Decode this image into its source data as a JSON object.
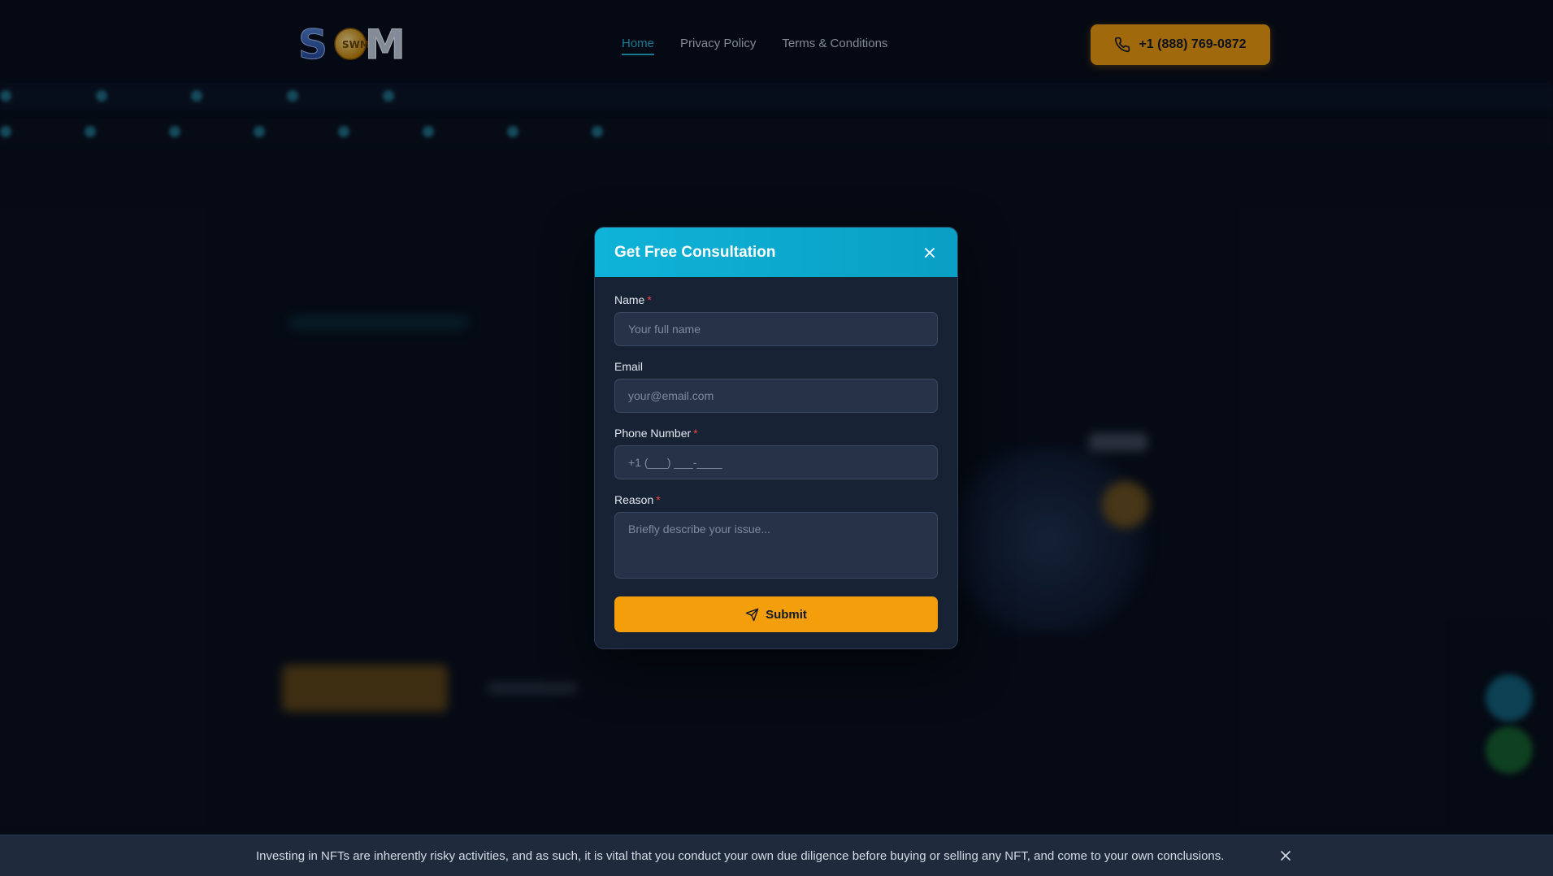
{
  "header": {
    "logo_text": "SWM",
    "nav": [
      {
        "label": "Home",
        "active": true
      },
      {
        "label": "Privacy Policy",
        "active": false
      },
      {
        "label": "Terms & Conditions",
        "active": false
      }
    ],
    "phone_label": "+1 (888) 769-0872"
  },
  "modal": {
    "title": "Get Free Consultation",
    "fields": {
      "name": {
        "label": "Name",
        "required_mark": "*",
        "placeholder": "Your full name"
      },
      "email": {
        "label": "Email",
        "placeholder": "your@email.com"
      },
      "phone": {
        "label": "Phone Number",
        "required_mark": "*",
        "placeholder": "+1 (___) ___-____"
      },
      "reason": {
        "label": "Reason",
        "required_mark": "*",
        "placeholder": "Briefly describe your issue..."
      }
    },
    "submit_label": "Submit"
  },
  "disclaimer": {
    "text": "Investing in NFTs are inherently risky activities, and as such, it is vital that you conduct your own due diligence before buying or selling any NFT, and come to your own conclusions."
  },
  "colors": {
    "accent_cyan": "#0fb3d8",
    "accent_gold": "#f59e0b",
    "background": "#070d18"
  }
}
